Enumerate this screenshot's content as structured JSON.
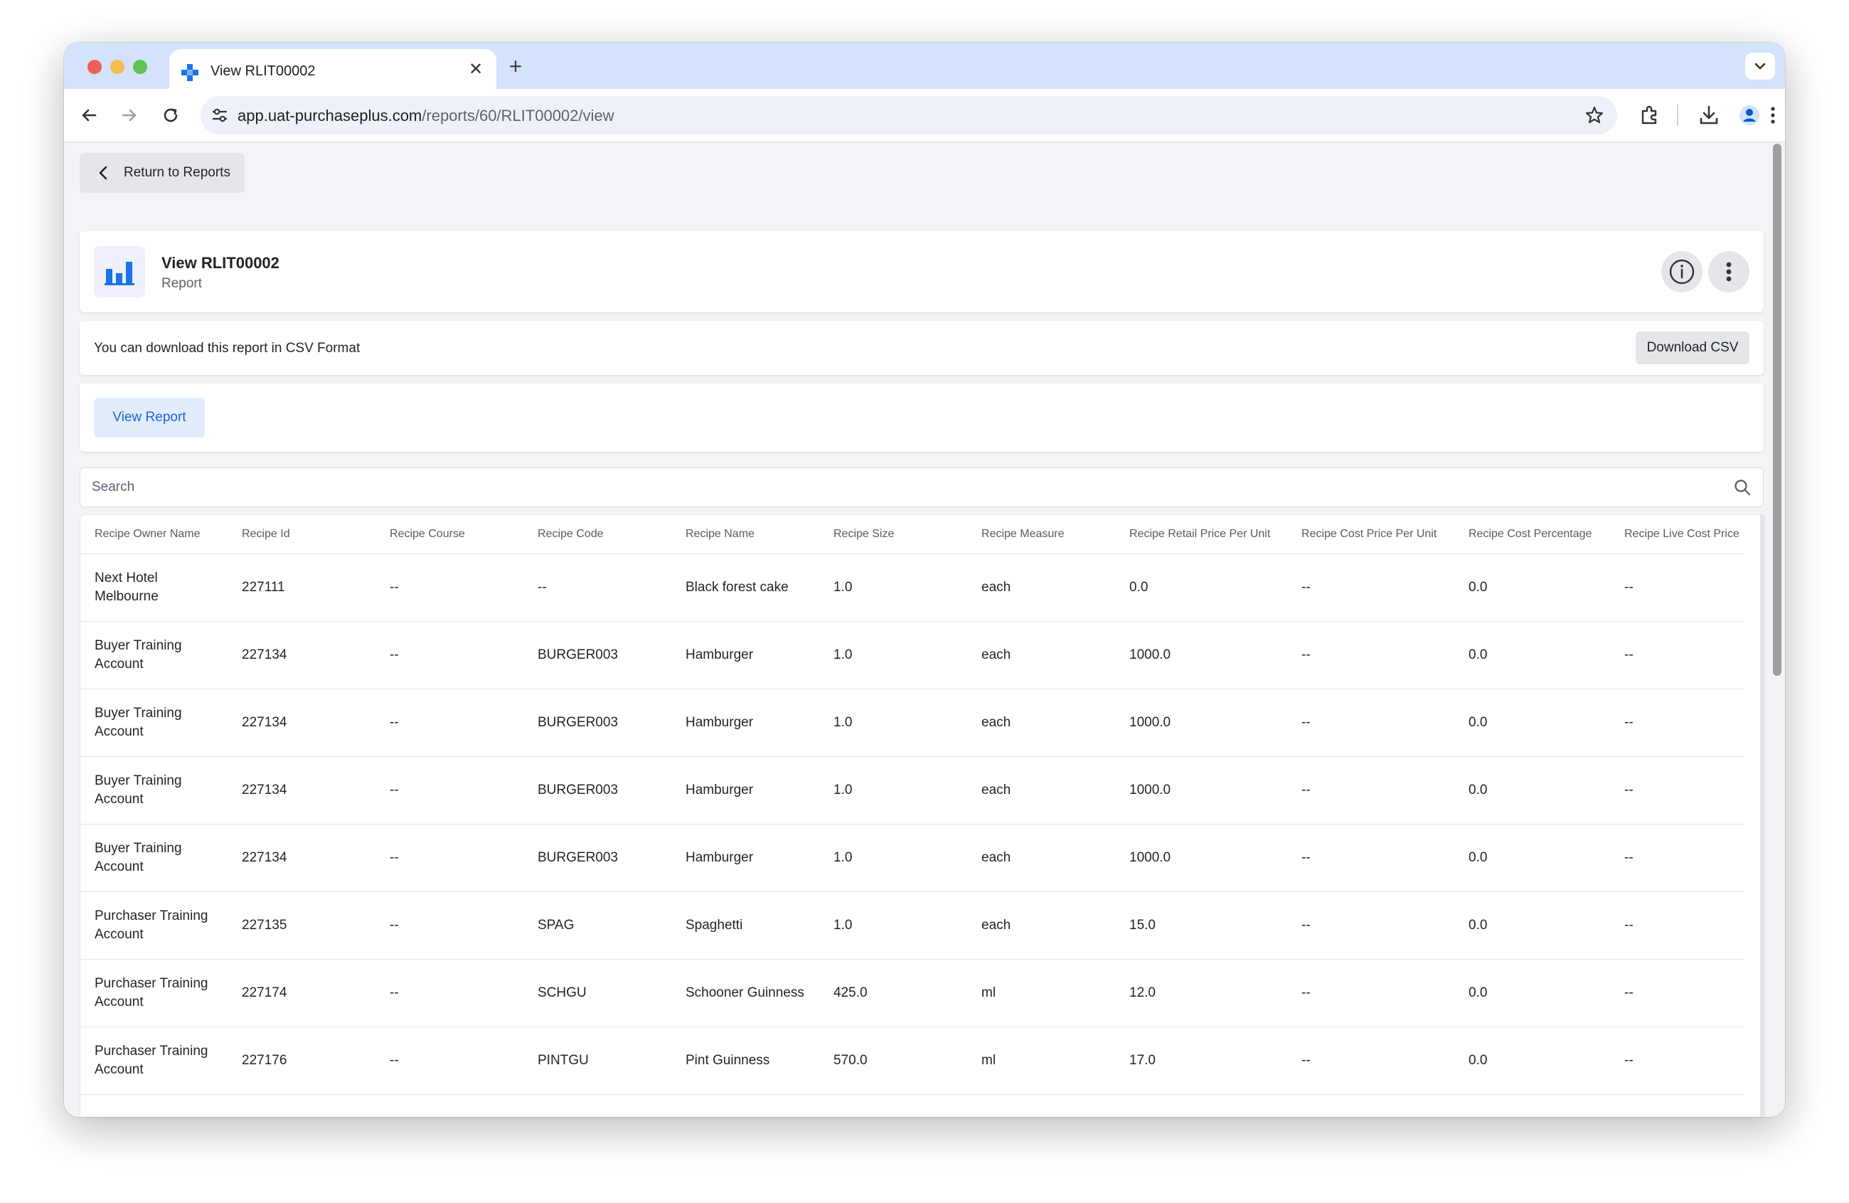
{
  "browser": {
    "tab_title": "View RLIT00002",
    "new_tab": "+",
    "close": "✕",
    "url_domain": "app.uat-purchaseplus.com",
    "url_path": "/reports/60/RLIT00002/view"
  },
  "nav": {
    "back_label": "Return to Reports"
  },
  "header": {
    "title": "View RLIT00002",
    "subtitle": "Report"
  },
  "csv": {
    "text": "You can download this report in CSV Format",
    "button": "Download CSV"
  },
  "view_button": "View Report",
  "search": {
    "placeholder": "Search"
  },
  "colors": {
    "accent": "#1e63d6",
    "brand_blue": "#1a73e8"
  },
  "table": {
    "columns": [
      "Recipe Owner Name",
      "Recipe Id",
      "Recipe Course",
      "Recipe Code",
      "Recipe Name",
      "Recipe Size",
      "Recipe Measure",
      "Recipe Retail Price Per Unit",
      "Recipe Cost Price Per Unit",
      "Recipe Cost Percentage",
      "Recipe Live Cost Price"
    ],
    "rows": [
      [
        "Next Hotel Melbourne",
        "227111",
        "--",
        "--",
        "Black forest cake",
        "1.0",
        "each",
        "0.0",
        "--",
        "0.0",
        "--"
      ],
      [
        "Buyer Training Account",
        "227134",
        "--",
        "BURGER003",
        "Hamburger",
        "1.0",
        "each",
        "1000.0",
        "--",
        "0.0",
        "--"
      ],
      [
        "Buyer Training Account",
        "227134",
        "--",
        "BURGER003",
        "Hamburger",
        "1.0",
        "each",
        "1000.0",
        "--",
        "0.0",
        "--"
      ],
      [
        "Buyer Training Account",
        "227134",
        "--",
        "BURGER003",
        "Hamburger",
        "1.0",
        "each",
        "1000.0",
        "--",
        "0.0",
        "--"
      ],
      [
        "Buyer Training Account",
        "227134",
        "--",
        "BURGER003",
        "Hamburger",
        "1.0",
        "each",
        "1000.0",
        "--",
        "0.0",
        "--"
      ],
      [
        "Purchaser Training Account",
        "227135",
        "--",
        "SPAG",
        "Spaghetti",
        "1.0",
        "each",
        "15.0",
        "--",
        "0.0",
        "--"
      ],
      [
        "Purchaser Training Account",
        "227174",
        "--",
        "SCHGU",
        "Schooner Guinness",
        "425.0",
        "ml",
        "12.0",
        "--",
        "0.0",
        "--"
      ],
      [
        "Purchaser Training Account",
        "227176",
        "--",
        "PINTGU",
        "Pint Guinness",
        "570.0",
        "ml",
        "17.0",
        "--",
        "0.0",
        "--"
      ]
    ]
  }
}
